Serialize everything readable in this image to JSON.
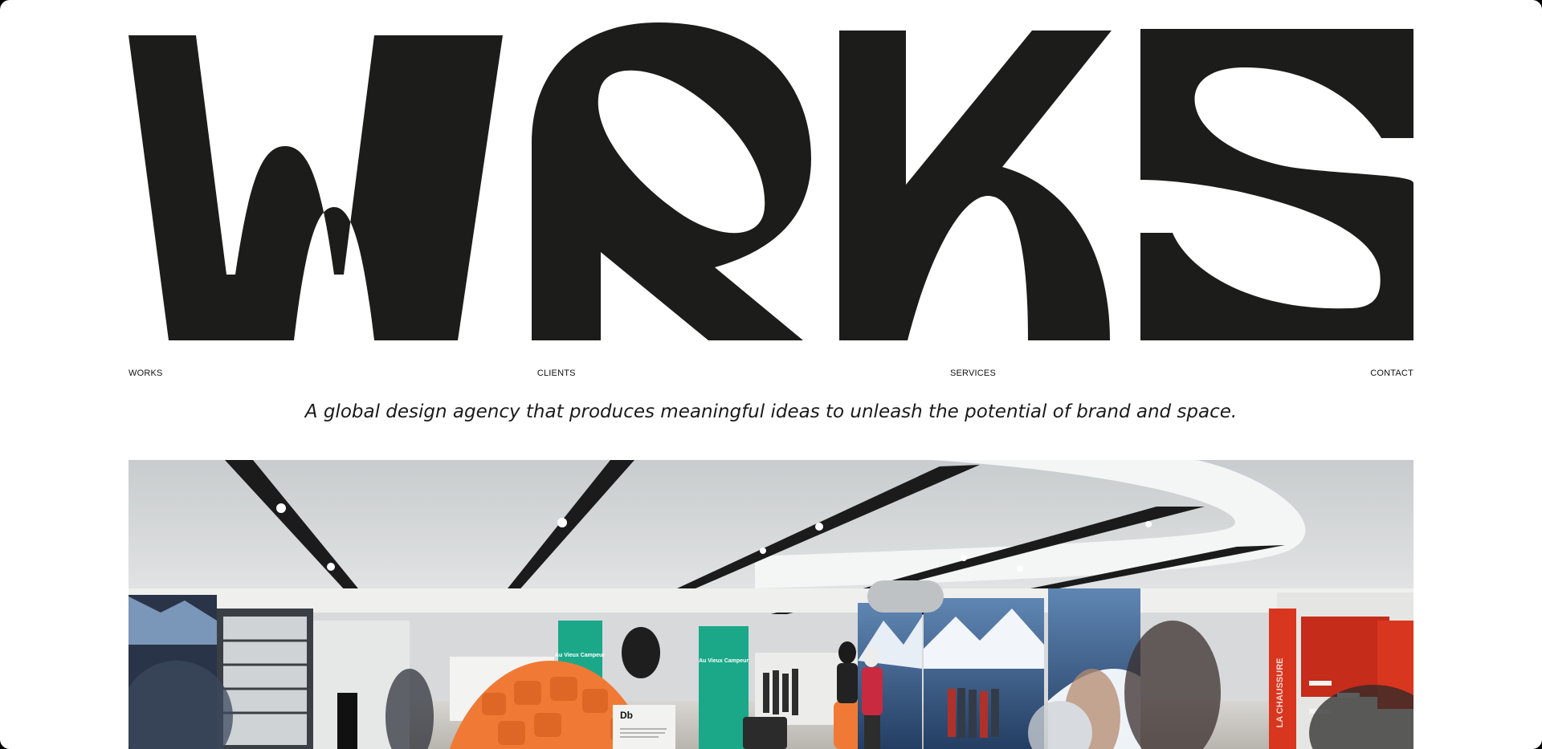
{
  "brand": {
    "logo_text": "WRKS"
  },
  "nav": {
    "items": [
      {
        "label": "WORKS"
      },
      {
        "label": "CLIENTS"
      },
      {
        "label": "SERVICES"
      },
      {
        "label": "CONTACT"
      }
    ]
  },
  "tagline": "A global design agency that produces meaningful ideas to unleash the potential of brand and space.",
  "hero": {
    "signs": {
      "pillar_left": "Au Vieux Campeur",
      "pillar_right": "Au Vieux Campeur",
      "shop_vertical": "LA CHAUSSURE",
      "display_card_logo": "Db"
    }
  },
  "colors": {
    "background": "#ffffff",
    "ink": "#1c1c1a",
    "accent_teal": "#1aa889",
    "accent_orange": "#f07a35",
    "accent_red": "#d9361f"
  }
}
